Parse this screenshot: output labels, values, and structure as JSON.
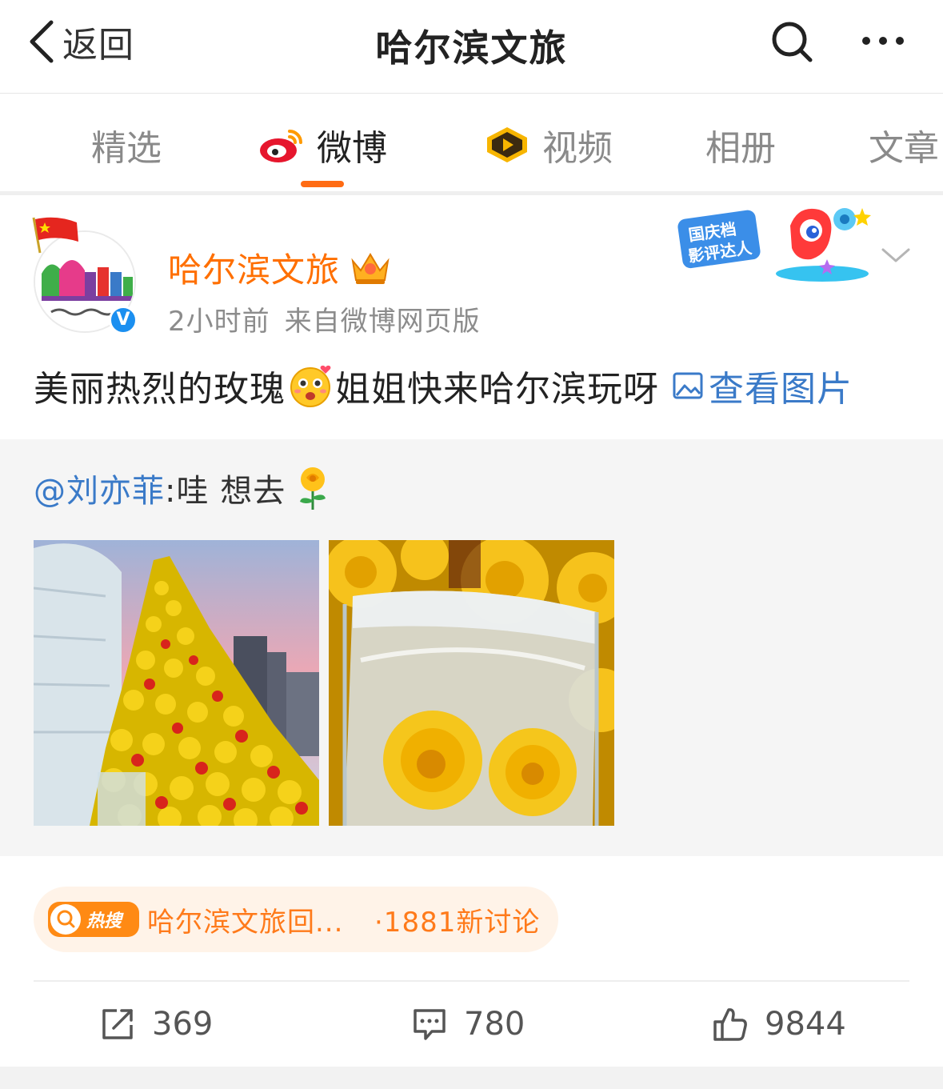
{
  "topbar": {
    "back_label": "返回",
    "title": "哈尔滨文旅",
    "icons": [
      "chevron-left-icon",
      "search-icon",
      "more-icon"
    ]
  },
  "tabs": [
    {
      "label": "精选",
      "active": false
    },
    {
      "label": "微博",
      "active": true,
      "icon": "weibo-logo-icon"
    },
    {
      "label": "视频",
      "active": false,
      "icon": "video-play-icon"
    },
    {
      "label": "相册",
      "active": false
    },
    {
      "label": "文章",
      "active": false
    }
  ],
  "colors": {
    "accent": "#ff6b13",
    "author": "#ff6f00",
    "link": "#3a7ac8",
    "hot_bg": "#fff3e8",
    "hot_text": "#ff7a1a",
    "verified": "#1b8ff0"
  },
  "post": {
    "author": "哈尔滨文旅",
    "verified_mark": "V",
    "time": "2小时前",
    "source": "来自微博网页版",
    "text_before": "美丽热烈的玫瑰",
    "text_after": "姐姐快来哈尔滨玩呀",
    "view_pictures": "查看图片",
    "badge_line1": "国庆档",
    "badge_line2": "影评达人"
  },
  "repost": {
    "mention": "@刘亦菲",
    "text": ":哇 想去"
  },
  "hot_search": {
    "tag": "热搜",
    "title": "哈尔滨文旅回...",
    "count": "·1881新讨论"
  },
  "actions": {
    "repost_count": "369",
    "comment_count": "780",
    "like_count": "9844"
  }
}
